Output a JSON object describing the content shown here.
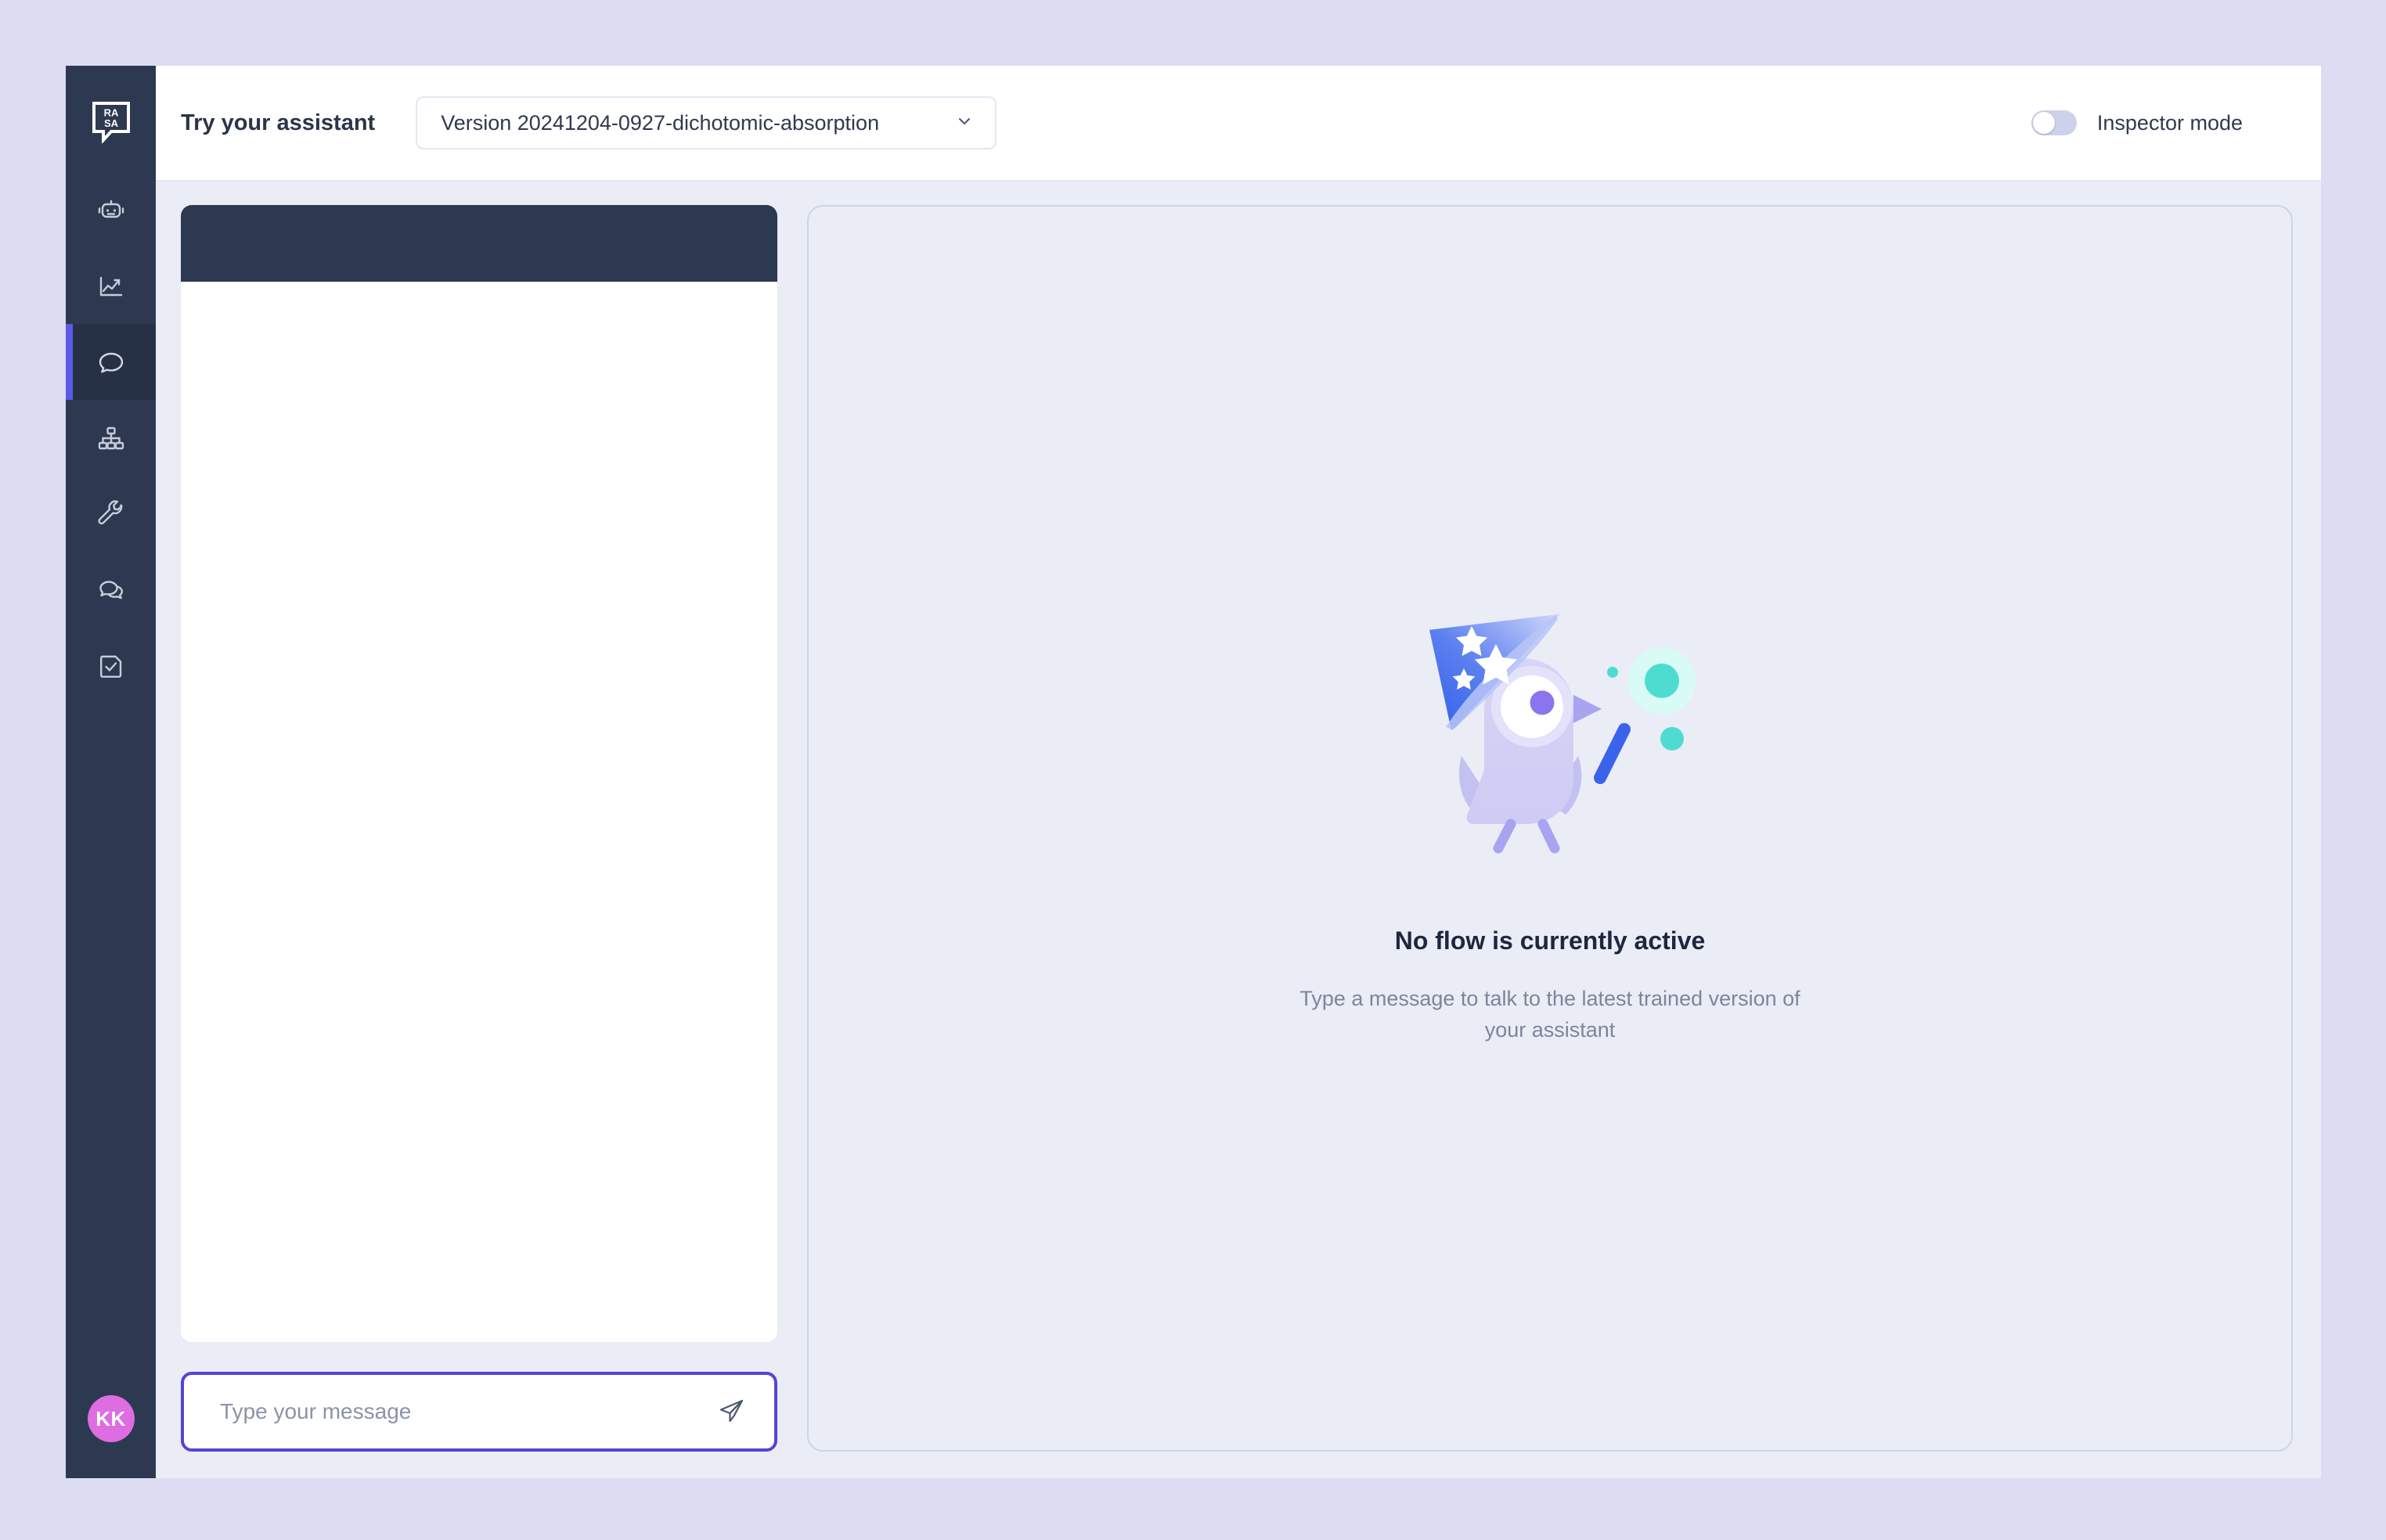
{
  "app": {
    "brand": "rasa-logo",
    "accent_purple": "#5841d8",
    "sidebar_bg": "#2d3950",
    "page_bg": "#dcdcf2",
    "workspace_bg": "#eaedf6"
  },
  "sidebar": {
    "logo_name": "rasa-logo",
    "items": [
      {
        "icon": "robot-icon",
        "name": "assistant",
        "active": false
      },
      {
        "icon": "analytics-chart-icon",
        "name": "analytics",
        "active": false
      },
      {
        "icon": "chat-bubble-icon",
        "name": "talk-to-assistant",
        "active": true
      },
      {
        "icon": "flow-tree-icon",
        "name": "flows",
        "active": false
      },
      {
        "icon": "wrench-icon",
        "name": "actions",
        "active": false
      },
      {
        "icon": "conversations-icon",
        "name": "conversations",
        "active": false
      },
      {
        "icon": "document-check-icon",
        "name": "tests",
        "active": false
      }
    ],
    "avatar": {
      "initials": "KK",
      "color": "#dd6de0"
    }
  },
  "topbar": {
    "title": "Try your assistant",
    "version_select": {
      "value": "Version 20241204-0927-dichotomic-absorption",
      "chevron": "chevron-down-icon"
    },
    "inspector": {
      "label": "Inspector mode",
      "enabled": false
    }
  },
  "chat": {
    "header_label": "",
    "messages": [],
    "composer": {
      "placeholder": "Type your message",
      "value": "",
      "send_icon": "send-paper-plane-icon"
    }
  },
  "flow_panel": {
    "illustration": "wizard-bird-illustration",
    "title": "No flow is currently active",
    "subtitle": "Type a message to talk to the latest trained version of your assistant"
  }
}
